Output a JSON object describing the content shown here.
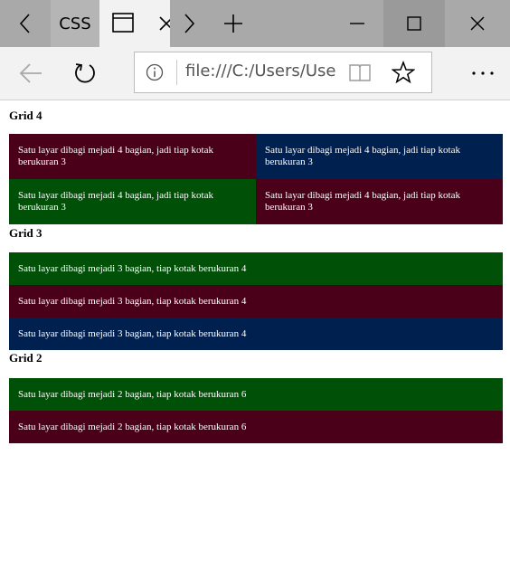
{
  "browser": {
    "tab_title": "CSS",
    "address_url": "file:///C:/Users/User",
    "icons": [
      "chevron-left-icon",
      "tab-window-icon",
      "chevron-right-icon",
      "plus-icon",
      "minimize-icon",
      "maximize-icon",
      "close-icon",
      "back-arrow-icon",
      "refresh-icon",
      "info-icon",
      "reading-view-icon",
      "star-icon",
      "more-icon"
    ]
  },
  "page": {
    "grid4": {
      "heading": "Grid 4",
      "boxes": [
        {
          "text": "Satu layar dibagi mejadi 4 bagian, jadi tiap kotak berukuran 3",
          "color": "#4a0018"
        },
        {
          "text": "Satu layar dibagi mejadi 4 bagian, jadi tiap kotak berukuran 3",
          "color": "#002050"
        },
        {
          "text": "Satu layar dibagi mejadi 4 bagian, jadi tiap kotak berukuran 3",
          "color": "#005008"
        },
        {
          "text": "Satu layar dibagi mejadi 4 bagian, jadi tiap kotak berukuran 3",
          "color": "#4a0018"
        }
      ]
    },
    "grid3": {
      "heading": "Grid 3",
      "boxes": [
        {
          "text": "Satu layar dibagi mejadi 3 bagian, tiap kotak berukuran 4",
          "color": "#005008"
        },
        {
          "text": "Satu layar dibagi mejadi 3 bagian, tiap kotak berukuran 4",
          "color": "#4a0018"
        },
        {
          "text": "Satu layar dibagi mejadi 3 bagian, tiap kotak berukuran 4",
          "color": "#002050"
        }
      ]
    },
    "grid2": {
      "heading": "Grid 2",
      "boxes": [
        {
          "text": "Satu layar dibagi mejadi 2 bagian, tiap kotak berukuran 6",
          "color": "#005008"
        },
        {
          "text": "Satu layar dibagi mejadi 2 bagian, tiap kotak berukuran 6",
          "color": "#4a0018"
        }
      ]
    }
  }
}
